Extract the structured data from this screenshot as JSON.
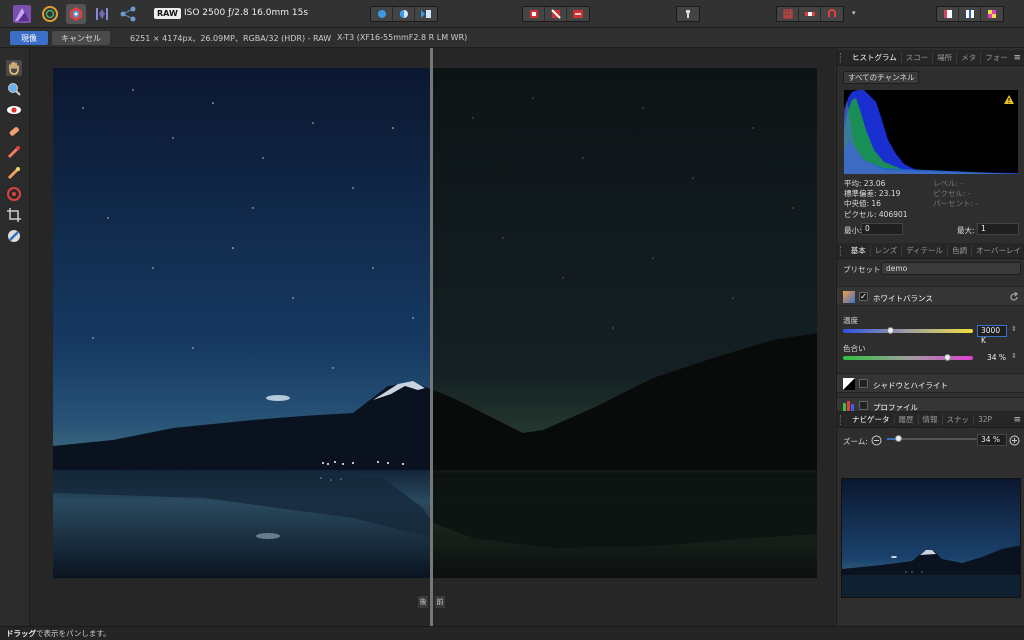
{
  "toolbar": {
    "raw_badge": "RAW",
    "exif": "ISO 2500 ƒ/2.8 16.0mm 15s"
  },
  "context": {
    "develop_label": "現像",
    "cancel_label": "キャンセル",
    "image_info": "6251 × 4174px、26.09MP、RGBA/32 (HDR) - RAW",
    "camera_info": "X-T3 (XF16-55mmF2.8 R LM WR)"
  },
  "histogram_panel": {
    "tabs": [
      "ヒストグラム",
      "スコー",
      "場所",
      "メタ",
      "フォー"
    ],
    "menu": "≡",
    "channel": "すべてのチャンネル",
    "mean": "平均: 23.06",
    "std": "標準偏差: 23.19",
    "median": "中央値: 16",
    "pixels": "ピクセル: 406901",
    "level": "レベル: -",
    "pixel_count": "ピクセル: -",
    "percent": "パーセント: -",
    "min_label": "最小:",
    "min_value": "0",
    "max_label": "最大:",
    "max_value": "1"
  },
  "basic_panel": {
    "tabs": [
      "基本",
      "レンズ",
      "ディテール",
      "色調",
      "オーバーレイ"
    ],
    "preset_label": "プリセット:",
    "preset_value": "demo",
    "white_balance": "ホワイトバランス",
    "temperature_label": "温度",
    "temperature_value": "3000 K",
    "temperature_level": 0.3,
    "tint_label": "色合い",
    "tint_value": "34 %",
    "tint_level": 0.84,
    "shadows_highlights": "シャドウとハイライト",
    "profile": "プロファイル"
  },
  "navigator_panel": {
    "tabs": [
      "ナビゲータ",
      "履歴",
      "情報",
      "スナッ",
      "32P"
    ],
    "menu": "≡",
    "zoom_label": "ズーム:",
    "zoom_value": "34 %"
  },
  "split_labels": {
    "before": "後",
    "after": "前"
  },
  "status": {
    "bold": "ドラッグ",
    "rest": "で表示をパンします。"
  },
  "colors": {
    "accent": "#3b6ec6",
    "warning": "#e8c020"
  }
}
